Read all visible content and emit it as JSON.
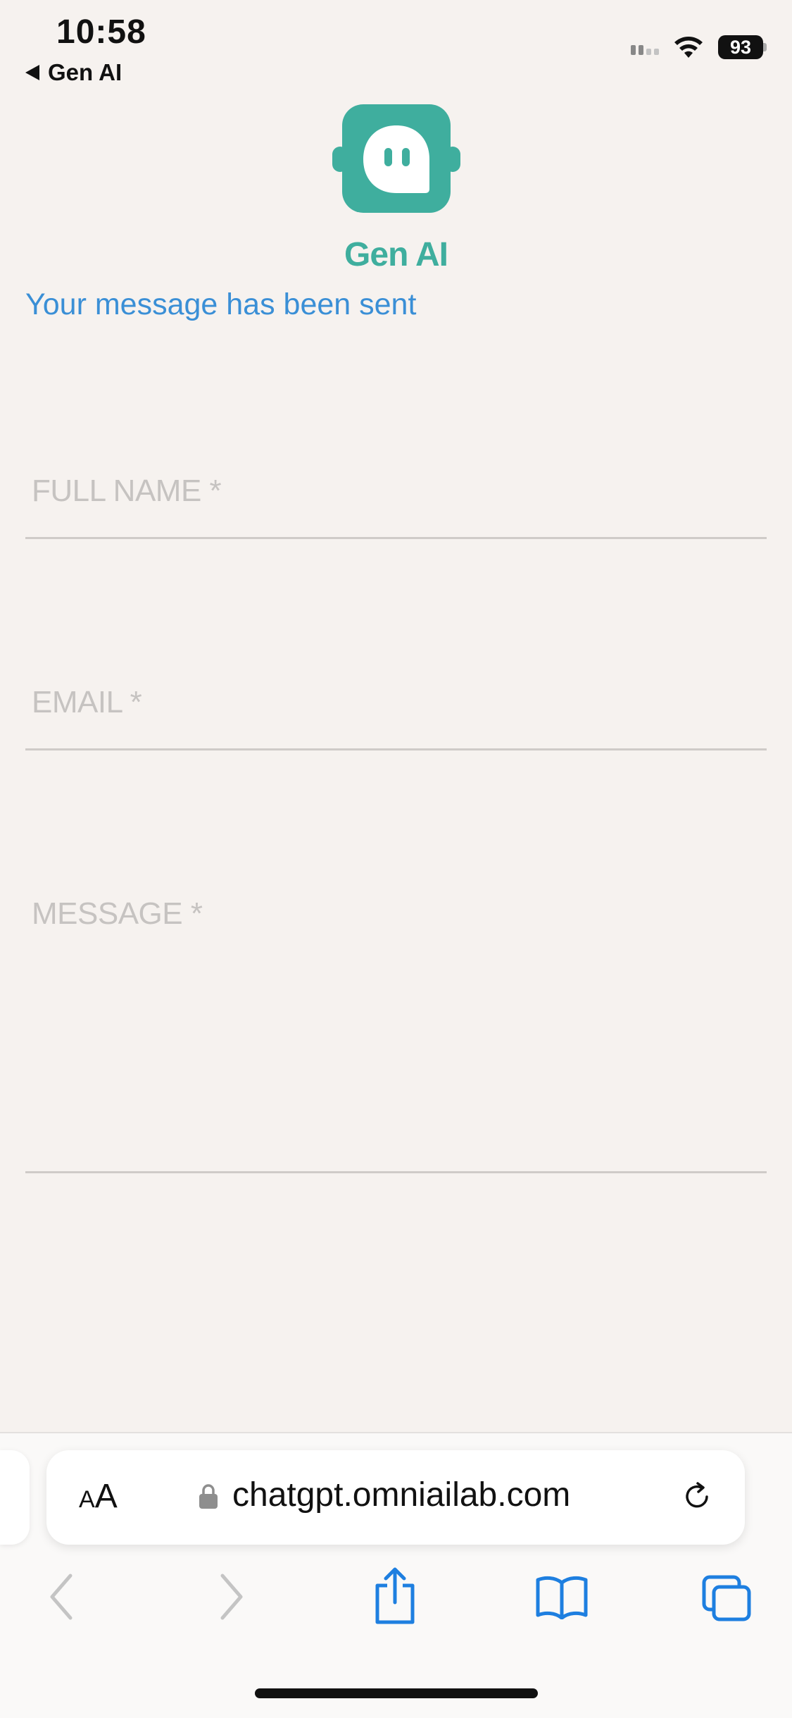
{
  "status_bar": {
    "time": "10:58",
    "back_label": "Gen AI",
    "battery": "93"
  },
  "app": {
    "logo_title": "Gen AI",
    "confirmation": "Your message has been sent",
    "brand_color": "#3fae9e"
  },
  "form": {
    "full_name_placeholder": "FULL NAME *",
    "email_placeholder": "EMAIL *",
    "message_placeholder": "MESSAGE *"
  },
  "browser": {
    "aa_small": "A",
    "aa_large": "A",
    "url": "chatgpt.omniailab.com",
    "accent": "#1e7fe0",
    "toolbar": [
      "back-icon",
      "forward-icon",
      "share-icon",
      "bookmarks-icon",
      "tabs-icon"
    ]
  }
}
